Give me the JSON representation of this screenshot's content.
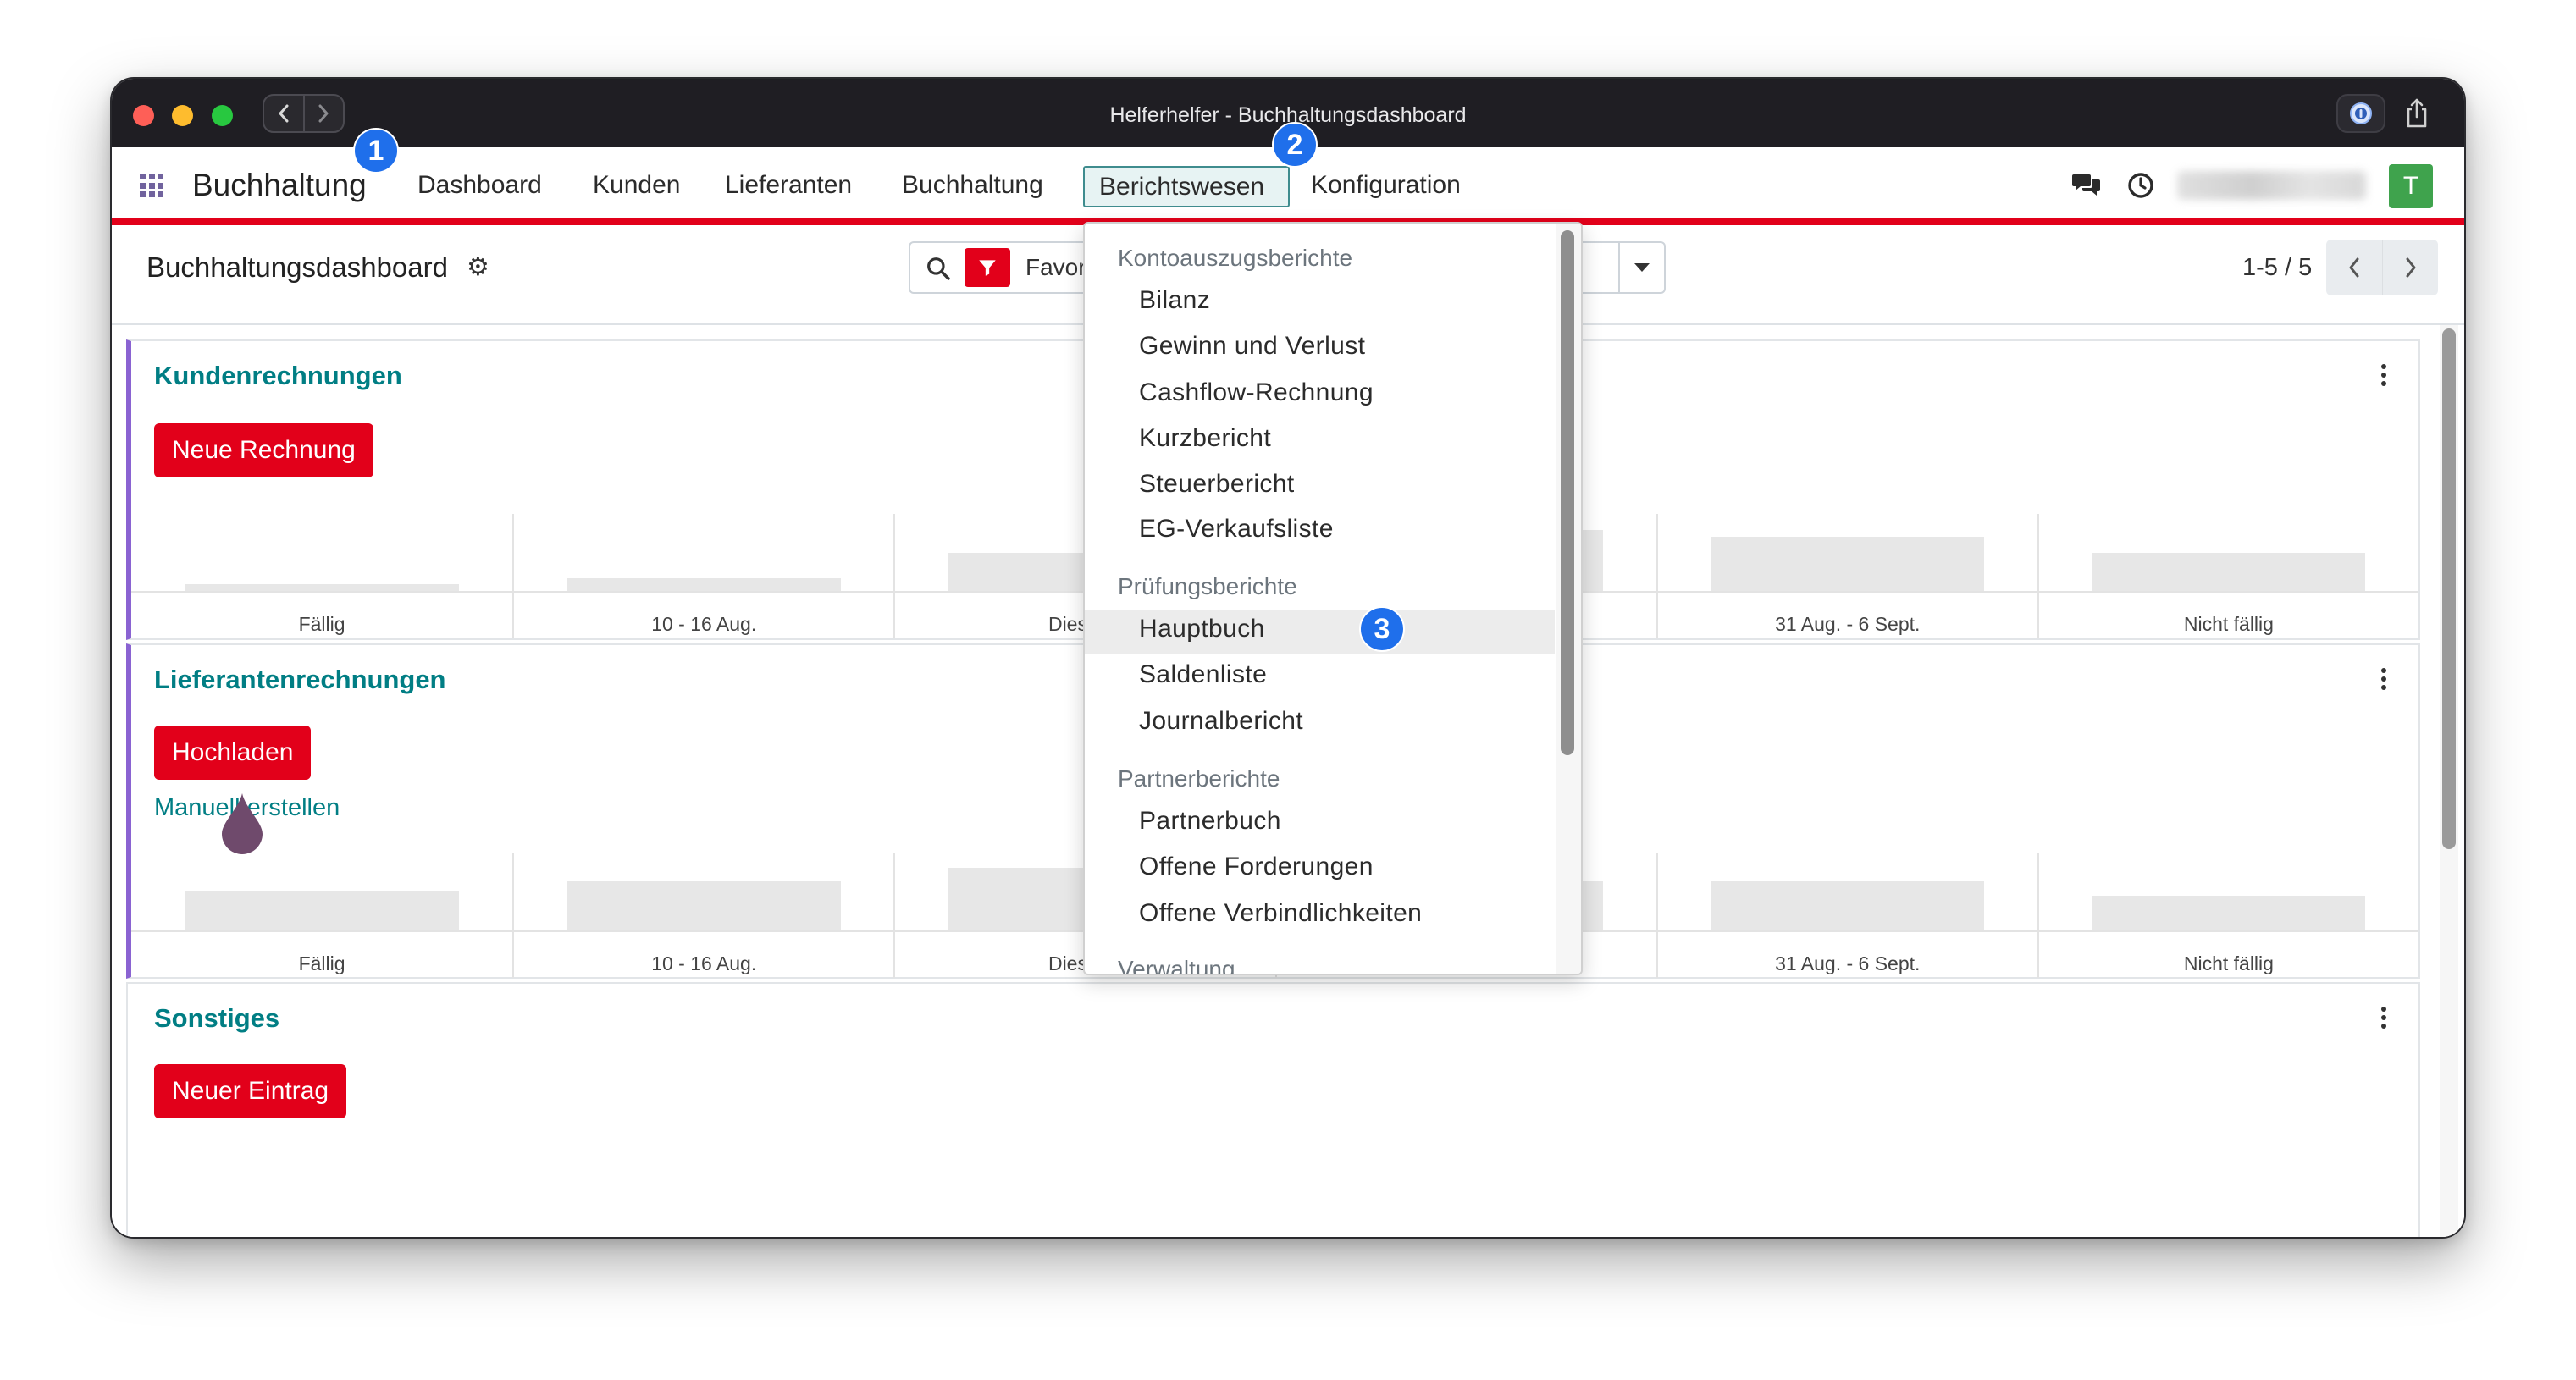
{
  "window": {
    "title": "Helferhelfer - Buchhaltungsdashboard"
  },
  "navbar": {
    "app_name": "Buchhaltung",
    "menu": [
      {
        "label": "Dashboard"
      },
      {
        "label": "Kunden"
      },
      {
        "label": "Lieferanten"
      },
      {
        "label": "Buchhaltung"
      },
      {
        "label": "Berichtswesen",
        "active": true
      },
      {
        "label": "Konfiguration"
      }
    ],
    "avatar_initial": "T"
  },
  "badges": [
    "1",
    "2",
    "3"
  ],
  "control_panel": {
    "title": "Buchhaltungsdashboard",
    "search_facet": "Favor",
    "pager": "1-5 / 5"
  },
  "cards": [
    {
      "title": "Kundenrechnungen",
      "action": "Neue Rechnung",
      "chart": {
        "categories": [
          "Fällig",
          "10 - 16 Aug.",
          "Diese W",
          "",
          "31 Aug. - 6 Sept.",
          "Nicht fällig"
        ],
        "levels": [
          0.09,
          0.17,
          0.49,
          0.79,
          0.7,
          0.49
        ]
      }
    },
    {
      "title": "Lieferantenrechnungen",
      "action": "Hochladen",
      "link": "Manuell erstellen",
      "chart": {
        "categories": [
          "Fällig",
          "10 - 16 Aug.",
          "Diese W",
          "",
          "31 Aug. - 6 Sept.",
          "Nicht fällig"
        ],
        "levels": [
          0.51,
          0.64,
          0.81,
          0.64,
          0.64,
          0.45
        ]
      }
    },
    {
      "title": "Sonstiges",
      "action": "Neuer Eintrag"
    }
  ],
  "reporting_menu": {
    "highlighted": {
      "section": 1,
      "item": 0
    },
    "sections": [
      {
        "header": "Kontoauszugsberichte",
        "items": [
          "Bilanz",
          "Gewinn und Verlust",
          "Cashflow-Rechnung",
          "Kurzbericht",
          "Steuerbericht",
          "EG-Verkaufsliste"
        ]
      },
      {
        "header": "Prüfungsberichte",
        "items": [
          "Hauptbuch",
          "Saldenliste",
          "Journalbericht"
        ]
      },
      {
        "header": "Partnerberichte",
        "items": [
          "Partnerbuch",
          "Offene Forderungen",
          "Offene Verbindlichkeiten"
        ]
      },
      {
        "header": "Verwaltung",
        "items": []
      }
    ]
  },
  "colors": {
    "accent_teal": "#017e84",
    "brand_red": "#e2001a",
    "card_accent_purple": "#8a63d2",
    "step_badge_blue": "#1f6feb",
    "avatar_green": "#3fa34d",
    "titlebar": "#1f1e23"
  },
  "icons": {
    "apps": "grid-icon",
    "chat": "chat-icon",
    "activity": "clock-icon",
    "settings": "gear-icon",
    "search": "search-icon",
    "filter": "filter-icon",
    "more": "kebab-icon",
    "cursor": "droplet-cursor-icon"
  }
}
